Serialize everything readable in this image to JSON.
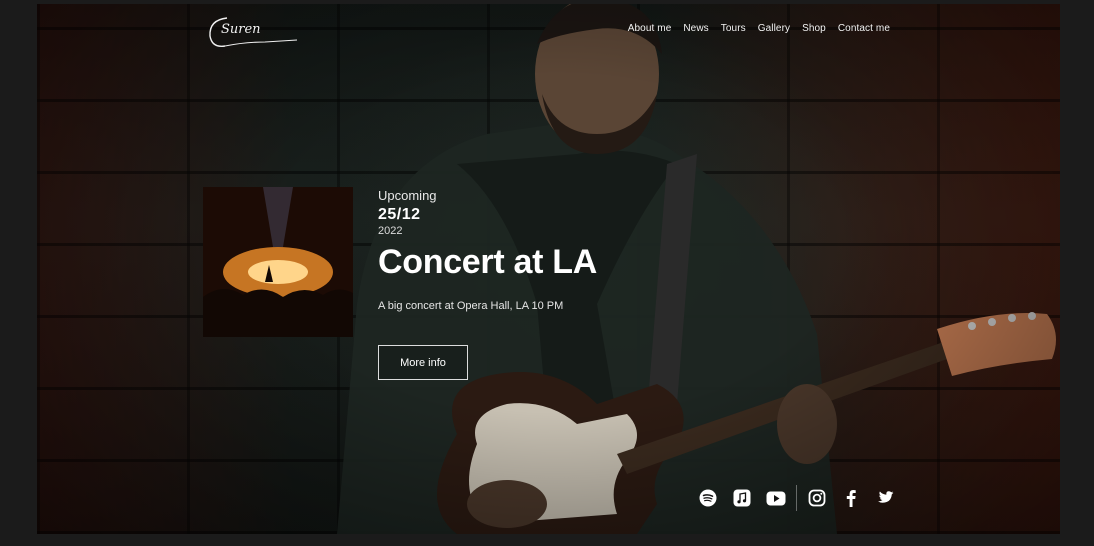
{
  "header": {
    "logo_text": "Suren",
    "nav": [
      "About me",
      "News",
      "Tours",
      "Gallery",
      "Shop",
      "Contact me"
    ]
  },
  "concert": {
    "label": "Upcoming",
    "day": "25/12",
    "year": "2022",
    "title": "Concert at LA",
    "description": "A big concert at Opera Hall, LA 10 PM",
    "button": "More info"
  },
  "social": {
    "icons": [
      "spotify-icon",
      "apple-music-icon",
      "youtube-icon",
      "instagram-icon",
      "facebook-icon",
      "twitter-icon"
    ]
  },
  "colors": {
    "text": "#ffffff",
    "accent_warm": "#d26a12"
  }
}
